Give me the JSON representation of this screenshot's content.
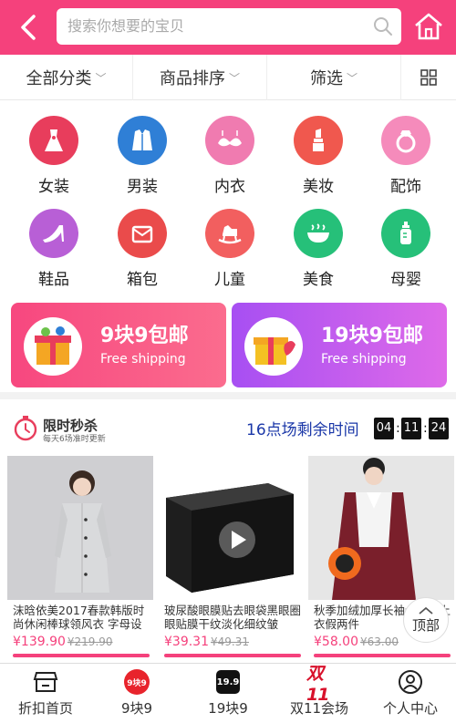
{
  "header": {
    "search_placeholder": "搜索你想要的宝贝"
  },
  "filter_bar": {
    "items": [
      {
        "label": "全部分类"
      },
      {
        "label": "商品排序"
      },
      {
        "label": "筛选"
      }
    ]
  },
  "categories": [
    {
      "label": "女装",
      "icon": "dress-icon",
      "color": "#e83d5c"
    },
    {
      "label": "男装",
      "icon": "suit-icon",
      "color": "#2f7fd6"
    },
    {
      "label": "内衣",
      "icon": "bra-icon",
      "color": "#f07bb0"
    },
    {
      "label": "美妆",
      "icon": "lipstick-icon",
      "color": "#f0584e"
    },
    {
      "label": "配饰",
      "icon": "ring-icon",
      "color": "#f58bbb"
    },
    {
      "label": "鞋品",
      "icon": "high-heel-icon",
      "color": "#b85fd6"
    },
    {
      "label": "箱包",
      "icon": "bag-icon",
      "color": "#ea4b4b"
    },
    {
      "label": "儿童",
      "icon": "rocking-horse-icon",
      "color": "#f25f5f"
    },
    {
      "label": "美食",
      "icon": "bowl-icon",
      "color": "#26c079"
    },
    {
      "label": "母婴",
      "icon": "baby-bottle-icon",
      "color": "#26c079"
    }
  ],
  "banners": [
    {
      "title": "9块9包邮",
      "subtitle": "Free shipping",
      "color_from": "#f7477f",
      "color_to": "#fb6c8e"
    },
    {
      "title": "19块9包邮",
      "subtitle": "Free shipping",
      "color_from": "#a74ff2",
      "color_to": "#de6ae9"
    }
  ],
  "flash_sale": {
    "title": "限时秒杀",
    "subtitle": "每天6场准时更新",
    "remaining_label": "16点场剩余时间",
    "timer": {
      "h": "04",
      "m": "11",
      "s": "24"
    }
  },
  "products": [
    {
      "title": "沫晗依美2017春款韩版时尚休闲棒球领风衣 字母设",
      "price": "¥139.90",
      "old_price": "¥219.90"
    },
    {
      "title": "玻尿酸眼膜贴去眼袋黑眼圈眼贴膜干纹淡化细纹皱",
      "price": "¥39.31",
      "old_price": "¥49.31"
    },
    {
      "title": "秋季加绒加厚长袖士秋装上衣假两件",
      "price": "¥58.00",
      "old_price": "¥63.00"
    }
  ],
  "to_top_label": "顶部",
  "tabbar": [
    {
      "label": "折扣首页",
      "icon": "shop-icon"
    },
    {
      "label": "9块9",
      "icon": "nine-nine-badge-icon",
      "badge": "9块9"
    },
    {
      "label": "19块9",
      "icon": "nineteen-nine-badge-icon",
      "badge": "19.9"
    },
    {
      "label": "双11会场",
      "icon": "double11-icon",
      "badge": "双11"
    },
    {
      "label": "个人中心",
      "icon": "user-icon"
    }
  ],
  "colors": {
    "accent": "#f5417c",
    "timer_text": "#1a37a8"
  }
}
